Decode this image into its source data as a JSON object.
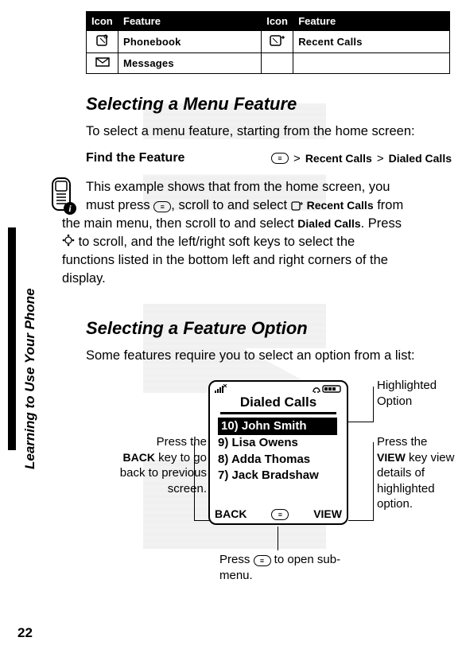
{
  "side_title": "Learning to Use Your Phone",
  "page_number": "22",
  "table": {
    "headers": [
      "Icon",
      "Feature",
      "Icon",
      "Feature"
    ],
    "rows": [
      {
        "icon1": "phonebook-icon",
        "label1": "Phonebook",
        "icon2": "recent-calls-icon",
        "label2": "Recent Calls"
      },
      {
        "icon1": "messages-icon",
        "label1": "Messages",
        "icon2": "",
        "label2": ""
      }
    ]
  },
  "heading1": "Selecting a Menu Feature",
  "para1": "To select a menu feature, starting from the home screen:",
  "find": {
    "label": "Find the Feature",
    "gt": ">",
    "recent": "Recent Calls",
    "dialed": "Dialed Calls"
  },
  "para2": {
    "l1a": "This example shows that from the home screen, you",
    "l2a": "must press ",
    "l2b": ", scroll to and select ",
    "l2c": " Recent Calls",
    "l2d": " from",
    "l3a": "the main menu, then scroll to and select ",
    "l3b": "Dialed Calls",
    "l3c": ". Press",
    "l4a": " to scroll, and the left/right soft keys to select the",
    "l5": "functions listed in the bottom left and right corners of the",
    "l6": "display."
  },
  "heading2": "Selecting a Feature Option",
  "para3": "Some features require you to select an option from a list:",
  "screen": {
    "title": "Dialed Calls",
    "items": [
      "10) John Smith",
      "9)  Lisa Owens",
      "8)  Adda Thomas",
      "7) Jack Bradshaw"
    ],
    "soft_left": "BACK",
    "soft_mid": "≡",
    "soft_right": "VIEW"
  },
  "annotations": {
    "highlighted": "Highlighted Option",
    "view_pre": "Press the ",
    "view_key": "VIEW",
    "view_post": " key view details of highlighted option.",
    "back_pre": "Press the ",
    "back_key": "BACK",
    "back_post": " key to go back to previous screen.",
    "menu_pre": "Press ",
    "menu_post": " to open sub-menu."
  }
}
